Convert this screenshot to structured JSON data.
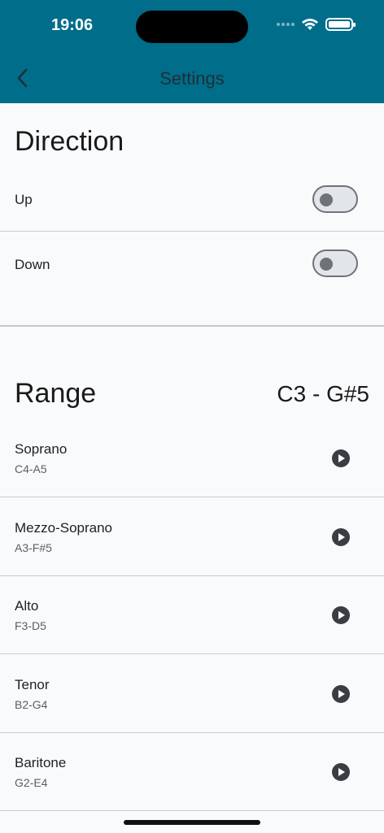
{
  "status_bar": {
    "time": "19:06"
  },
  "header": {
    "title": "Settings",
    "back_icon": "chevron-left-icon"
  },
  "direction": {
    "title": "Direction",
    "options": [
      {
        "label": "Up",
        "on": false
      },
      {
        "label": "Down",
        "on": false
      }
    ]
  },
  "range": {
    "title": "Range",
    "value": "C3 - G#5",
    "voices": [
      {
        "name": "Soprano",
        "range": "C4-A5"
      },
      {
        "name": "Mezzo-Soprano",
        "range": "A3-F#5"
      },
      {
        "name": "Alto",
        "range": "F3-D5"
      },
      {
        "name": "Tenor",
        "range": "B2-G4"
      },
      {
        "name": "Baritone",
        "range": "G2-E4"
      }
    ]
  },
  "colors": {
    "header": "#006d8a",
    "background": "#f9fafc",
    "play": "#3a3e42"
  }
}
